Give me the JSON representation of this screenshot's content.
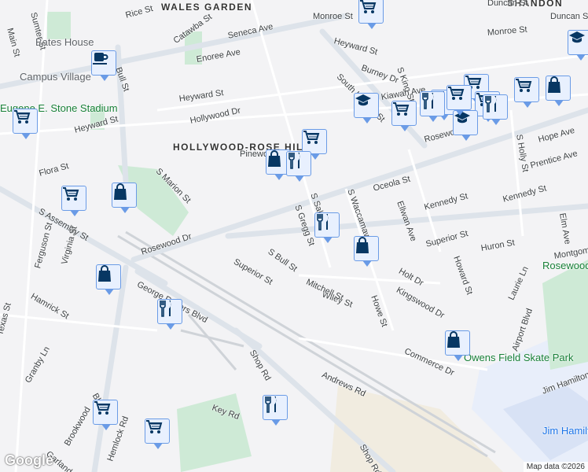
{
  "map": {
    "neighborhoods": [
      "WALES GARDEN",
      "SHANDON",
      "HOLLYWOOD-ROSE HILL"
    ],
    "pois": {
      "bates_house": "Bates House",
      "campus_village": "Campus Village",
      "stadium": "Eugene E. Stone Stadium",
      "skate_park": "Owens Field Skate Park",
      "rosewood_park": "Rosewood Park",
      "airport": "Jim Hamilton - LB Owens Airport (CUB)"
    },
    "streets": [
      "Rice St",
      "Seneca Ave",
      "Catawba St",
      "Enoree Ave",
      "Heyward St",
      "Hollywood Dr",
      "Heyward St",
      "Flora St",
      "S Marion St",
      "Pinewood",
      "Rosewood Dr",
      "S Assembly St",
      "Ferguson St",
      "Virginia St",
      "Hamrick St",
      "Texas St",
      "Hemlock Rd",
      "George Rogers Blvd",
      "Superior St",
      "S Bull St",
      "Wiley St",
      "Mitchell St",
      "S Gregg St",
      "S Saluda",
      "S Waccamaw Ave",
      "Ellwan Ave",
      "Oceola St",
      "Kennedy St",
      "Kennedy St",
      "Superior St",
      "Holt Dr",
      "Huron St",
      "Howard St",
      "Kingswood Dr",
      "Howe St",
      "Commerce Dr",
      "Andrews Rd",
      "Shop Rd",
      "Granby Ln",
      "Bluff Rd",
      "Garland St",
      "Brookwood",
      "Key Rd",
      "Monroe St",
      "Duncan St",
      "Duncan St",
      "Monroe St",
      "Heyward St",
      "Burney Dr",
      "S King St",
      "Kiawah Ave",
      "South Harden St",
      "Rosewood Dr",
      "Hope Ave",
      "Prentice Ave",
      "S Holly St",
      "Elm Ave",
      "Montgomery",
      "Laurie Ln",
      "Airport Blvd",
      "Jim Hamilton",
      "Bull St",
      "Main St",
      "Sumter St",
      "Shop Rd"
    ],
    "markers": [
      "cart",
      "coffee",
      "cart",
      "cart",
      "bag",
      "restaurant",
      "cart",
      "bag",
      "restaurant",
      "bag",
      "bag",
      "restaurant",
      "bag",
      "cart",
      "cart",
      "restaurant",
      "school",
      "cart",
      "cart",
      "restaurant",
      "restaurant",
      "cart",
      "school",
      "cart",
      "bag",
      "school",
      "cart",
      "restaurant"
    ],
    "attribution": "Map data ©2026",
    "logo": "Google"
  }
}
